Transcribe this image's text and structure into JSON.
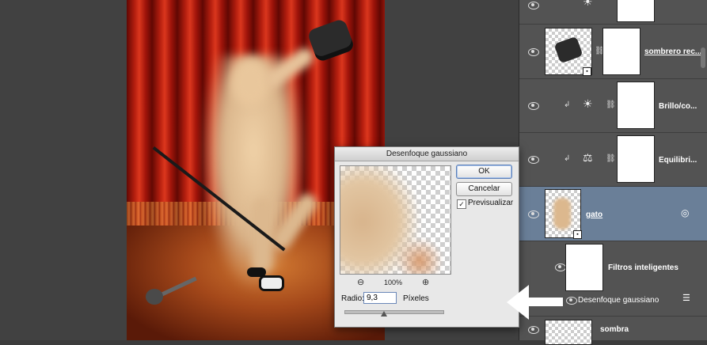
{
  "dialog": {
    "title": "Desenfoque gaussiano",
    "ok_label": "OK",
    "cancel_label": "Cancelar",
    "preview_label": "Previsualizar",
    "preview_checked": true,
    "zoom_level": "100%",
    "zoom_out_icon": "zoom-out-icon",
    "zoom_in_icon": "zoom-in-icon",
    "radius_label": "Radio:",
    "radius_value": "9,3",
    "radius_unit": "Píxeles",
    "radius_slider_fraction": 0.4
  },
  "layers": [
    {
      "label": "",
      "type": "adjustment",
      "visible": true
    },
    {
      "label": "sombrero rec...",
      "type": "smart-object",
      "visible": true
    },
    {
      "label": "Brillo/co...",
      "type": "adjustment",
      "visible": true
    },
    {
      "label": "Equilibri...",
      "type": "adjustment",
      "visible": true
    },
    {
      "label": "gato",
      "type": "smart-object",
      "visible": true,
      "selected": true
    },
    {
      "label": "Filtros inteligentes",
      "type": "smart-filters",
      "visible": true
    },
    {
      "label": "Desenfoque gaussiano",
      "type": "filter",
      "visible": true
    },
    {
      "label": "sombra",
      "type": "layer",
      "visible": true
    }
  ],
  "colors": {
    "selected_layer": "#6a7f98",
    "panel_bg": "#535353",
    "arrow": "#ffffff"
  }
}
